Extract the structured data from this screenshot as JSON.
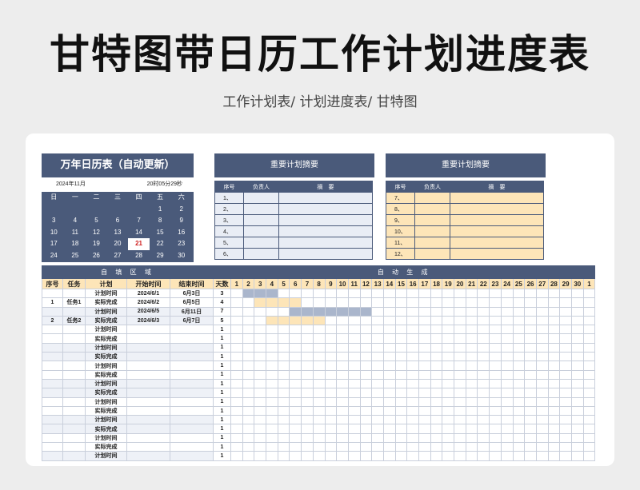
{
  "title": "甘特图带日历工作计划进度表",
  "subtitle": "工作计划表/ 计划进度表/ 甘特图",
  "calendar": {
    "title": "万年日历表（自动更新）",
    "month": "2024年11月",
    "time": "20时05分29秒",
    "weekdays": [
      "日",
      "一",
      "二",
      "三",
      "四",
      "五",
      "六"
    ],
    "rows": [
      [
        "",
        "",
        "",
        "",
        "",
        "1",
        "2"
      ],
      [
        "3",
        "4",
        "5",
        "6",
        "7",
        "8",
        "9"
      ],
      [
        "10",
        "11",
        "12",
        "13",
        "14",
        "15",
        "16"
      ],
      [
        "17",
        "18",
        "19",
        "20",
        "21",
        "22",
        "23"
      ],
      [
        "24",
        "25",
        "26",
        "27",
        "28",
        "29",
        "30"
      ]
    ],
    "today": "21"
  },
  "summary_left": {
    "title": "重要计划摘要",
    "headers": [
      "序号",
      "负责人",
      "摘　要"
    ],
    "rows": [
      "1、",
      "2、",
      "3、",
      "4、",
      "5、",
      "6、"
    ]
  },
  "summary_right": {
    "title": "重要计划摘要",
    "headers": [
      "序号",
      "负责人",
      "摘　要"
    ],
    "rows": [
      "7、",
      "8、",
      "9、",
      "10、",
      "11、",
      "12、"
    ]
  },
  "gantt": {
    "left_header": "自 填 区 域",
    "right_header": "自 动 生 成",
    "columns": [
      "序号",
      "任务",
      "计划",
      "开始时间",
      "结束时间",
      "天数"
    ],
    "days": [
      "1",
      "2",
      "3",
      "4",
      "5",
      "6",
      "7",
      "8",
      "9",
      "10",
      "11",
      "12",
      "13",
      "14",
      "15",
      "16",
      "17",
      "18",
      "19",
      "20",
      "21",
      "22",
      "23",
      "24",
      "25",
      "26",
      "27",
      "28",
      "29",
      "30",
      "1"
    ],
    "rows": [
      {
        "no": "",
        "task": "",
        "type": "计划时间",
        "start": "2024/6/1",
        "end": "6月3日",
        "days": "3",
        "bar": "plan",
        "from": 1,
        "len": 3
      },
      {
        "no": "1",
        "task": "任务1",
        "type": "实际完成",
        "start": "2024/6/2",
        "end": "6月5日",
        "days": "4",
        "bar": "real",
        "from": 2,
        "len": 4
      },
      {
        "no": "",
        "task": "",
        "type": "计划时间",
        "start": "2024/6/5",
        "end": "6月11日",
        "days": "7",
        "bar": "plan",
        "from": 5,
        "len": 7
      },
      {
        "no": "2",
        "task": "任务2",
        "type": "实际完成",
        "start": "2024/6/3",
        "end": "6月7日",
        "days": "5",
        "bar": "real",
        "from": 3,
        "len": 5
      },
      {
        "no": "",
        "task": "",
        "type": "计划时间",
        "start": "",
        "end": "",
        "days": "1"
      },
      {
        "no": "",
        "task": "",
        "type": "实际完成",
        "start": "",
        "end": "",
        "days": "1"
      },
      {
        "no": "",
        "task": "",
        "type": "计划时间",
        "start": "",
        "end": "",
        "days": "1"
      },
      {
        "no": "",
        "task": "",
        "type": "实际完成",
        "start": "",
        "end": "",
        "days": "1"
      },
      {
        "no": "",
        "task": "",
        "type": "计划时间",
        "start": "",
        "end": "",
        "days": "1"
      },
      {
        "no": "",
        "task": "",
        "type": "实际完成",
        "start": "",
        "end": "",
        "days": "1"
      },
      {
        "no": "",
        "task": "",
        "type": "计划时间",
        "start": "",
        "end": "",
        "days": "1"
      },
      {
        "no": "",
        "task": "",
        "type": "实际完成",
        "start": "",
        "end": "",
        "days": "1"
      },
      {
        "no": "",
        "task": "",
        "type": "计划时间",
        "start": "",
        "end": "",
        "days": "1"
      },
      {
        "no": "",
        "task": "",
        "type": "实际完成",
        "start": "",
        "end": "",
        "days": "1"
      },
      {
        "no": "",
        "task": "",
        "type": "计划时间",
        "start": "",
        "end": "",
        "days": "1"
      },
      {
        "no": "",
        "task": "",
        "type": "实际完成",
        "start": "",
        "end": "",
        "days": "1"
      },
      {
        "no": "",
        "task": "",
        "type": "计划时间",
        "start": "",
        "end": "",
        "days": "1"
      },
      {
        "no": "",
        "task": "",
        "type": "实际完成",
        "start": "",
        "end": "",
        "days": "1"
      },
      {
        "no": "",
        "task": "",
        "type": "计划时间",
        "start": "",
        "end": "",
        "days": "1"
      }
    ]
  },
  "colors": {
    "header": "#4a5a7a",
    "plan_bar": "#aab6cc",
    "real_bar": "#fde5b8",
    "today": "#d02020"
  }
}
